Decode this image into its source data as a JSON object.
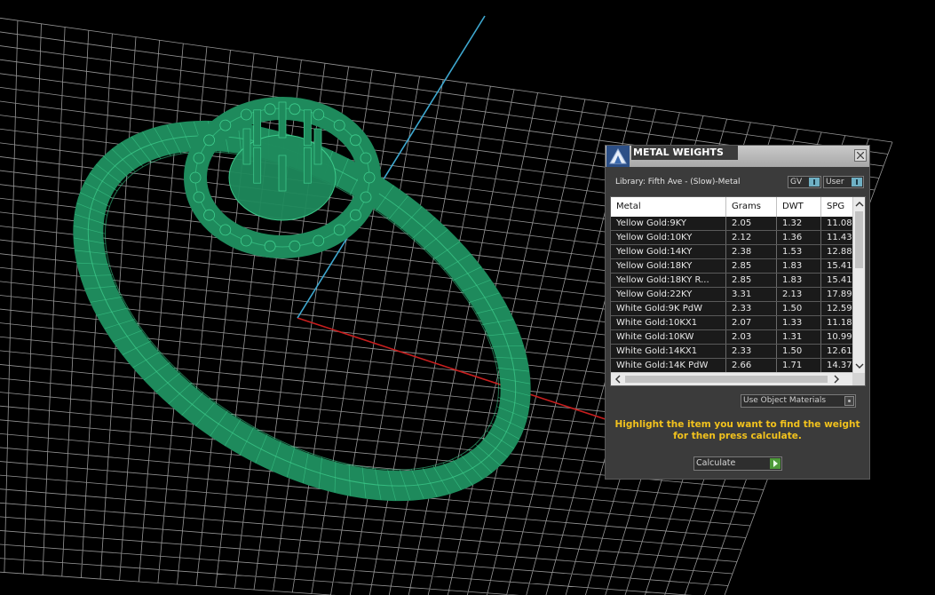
{
  "viewport": {
    "background": "#000000",
    "grid_color": "#c8c8c8",
    "model_color": "#1e8a5c",
    "model_wire_color": "#3fd08f",
    "axis_x_color": "#c81e1e",
    "axis_z_color": "#3ea8d0"
  },
  "panel": {
    "title": "METAL WEIGHTS",
    "title_icon": "triangle-logo-icon",
    "close_icon": "close-icon",
    "library_label": "Library: Fifth Ave - (Slow)-Metal",
    "toggles": [
      {
        "label": "GV"
      },
      {
        "label": "User"
      }
    ],
    "table": {
      "columns": [
        "Metal",
        "Grams",
        "DWT",
        "SPG"
      ],
      "rows": [
        {
          "metal": "Yellow Gold:9KY",
          "grams": "2.05",
          "dwt": "1.32",
          "spg": "11.08"
        },
        {
          "metal": "Yellow Gold:10KY",
          "grams": "2.12",
          "dwt": "1.36",
          "spg": "11.43"
        },
        {
          "metal": "Yellow Gold:14KY",
          "grams": "2.38",
          "dwt": "1.53",
          "spg": "12.88"
        },
        {
          "metal": "Yellow Gold:18KY",
          "grams": "2.85",
          "dwt": "1.83",
          "spg": "15.41"
        },
        {
          "metal": "Yellow Gold:18KY R...",
          "grams": "2.85",
          "dwt": "1.83",
          "spg": "15.41"
        },
        {
          "metal": "Yellow Gold:22KY",
          "grams": "3.31",
          "dwt": "2.13",
          "spg": "17.89"
        },
        {
          "metal": "White Gold:9K PdW",
          "grams": "2.33",
          "dwt": "1.50",
          "spg": "12.59"
        },
        {
          "metal": "White Gold:10KX1",
          "grams": "2.07",
          "dwt": "1.33",
          "spg": "11.18"
        },
        {
          "metal": "White Gold:10KW",
          "grams": "2.03",
          "dwt": "1.31",
          "spg": "10.99"
        },
        {
          "metal": "White Gold:14KX1",
          "grams": "2.33",
          "dwt": "1.50",
          "spg": "12.61"
        },
        {
          "metal": "White Gold:14K PdW",
          "grams": "2.66",
          "dwt": "1.71",
          "spg": "14.37"
        }
      ]
    },
    "use_materials_label": "Use Object Materials",
    "instruction": "Highlight the item you want to find the weight for then press calculate.",
    "calculate_label": "Calculate"
  }
}
